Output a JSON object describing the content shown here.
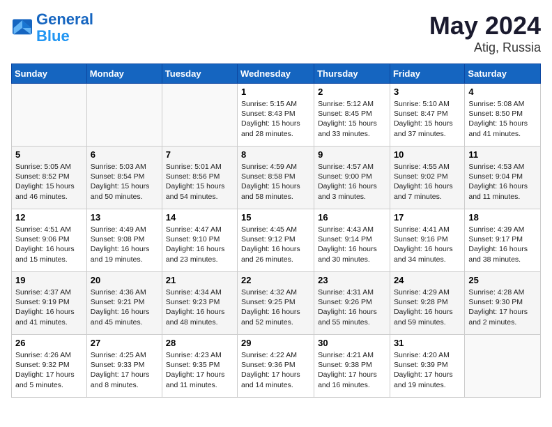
{
  "header": {
    "logo_line1": "General",
    "logo_line2": "Blue",
    "month_year": "May 2024",
    "location": "Atig, Russia"
  },
  "days_of_week": [
    "Sunday",
    "Monday",
    "Tuesday",
    "Wednesday",
    "Thursday",
    "Friday",
    "Saturday"
  ],
  "weeks": [
    [
      {
        "day": "",
        "info": ""
      },
      {
        "day": "",
        "info": ""
      },
      {
        "day": "",
        "info": ""
      },
      {
        "day": "1",
        "info": "Sunrise: 5:15 AM\nSunset: 8:43 PM\nDaylight: 15 hours\nand 28 minutes."
      },
      {
        "day": "2",
        "info": "Sunrise: 5:12 AM\nSunset: 8:45 PM\nDaylight: 15 hours\nand 33 minutes."
      },
      {
        "day": "3",
        "info": "Sunrise: 5:10 AM\nSunset: 8:47 PM\nDaylight: 15 hours\nand 37 minutes."
      },
      {
        "day": "4",
        "info": "Sunrise: 5:08 AM\nSunset: 8:50 PM\nDaylight: 15 hours\nand 41 minutes."
      }
    ],
    [
      {
        "day": "5",
        "info": "Sunrise: 5:05 AM\nSunset: 8:52 PM\nDaylight: 15 hours\nand 46 minutes."
      },
      {
        "day": "6",
        "info": "Sunrise: 5:03 AM\nSunset: 8:54 PM\nDaylight: 15 hours\nand 50 minutes."
      },
      {
        "day": "7",
        "info": "Sunrise: 5:01 AM\nSunset: 8:56 PM\nDaylight: 15 hours\nand 54 minutes."
      },
      {
        "day": "8",
        "info": "Sunrise: 4:59 AM\nSunset: 8:58 PM\nDaylight: 15 hours\nand 58 minutes."
      },
      {
        "day": "9",
        "info": "Sunrise: 4:57 AM\nSunset: 9:00 PM\nDaylight: 16 hours\nand 3 minutes."
      },
      {
        "day": "10",
        "info": "Sunrise: 4:55 AM\nSunset: 9:02 PM\nDaylight: 16 hours\nand 7 minutes."
      },
      {
        "day": "11",
        "info": "Sunrise: 4:53 AM\nSunset: 9:04 PM\nDaylight: 16 hours\nand 11 minutes."
      }
    ],
    [
      {
        "day": "12",
        "info": "Sunrise: 4:51 AM\nSunset: 9:06 PM\nDaylight: 16 hours\nand 15 minutes."
      },
      {
        "day": "13",
        "info": "Sunrise: 4:49 AM\nSunset: 9:08 PM\nDaylight: 16 hours\nand 19 minutes."
      },
      {
        "day": "14",
        "info": "Sunrise: 4:47 AM\nSunset: 9:10 PM\nDaylight: 16 hours\nand 23 minutes."
      },
      {
        "day": "15",
        "info": "Sunrise: 4:45 AM\nSunset: 9:12 PM\nDaylight: 16 hours\nand 26 minutes."
      },
      {
        "day": "16",
        "info": "Sunrise: 4:43 AM\nSunset: 9:14 PM\nDaylight: 16 hours\nand 30 minutes."
      },
      {
        "day": "17",
        "info": "Sunrise: 4:41 AM\nSunset: 9:16 PM\nDaylight: 16 hours\nand 34 minutes."
      },
      {
        "day": "18",
        "info": "Sunrise: 4:39 AM\nSunset: 9:17 PM\nDaylight: 16 hours\nand 38 minutes."
      }
    ],
    [
      {
        "day": "19",
        "info": "Sunrise: 4:37 AM\nSunset: 9:19 PM\nDaylight: 16 hours\nand 41 minutes."
      },
      {
        "day": "20",
        "info": "Sunrise: 4:36 AM\nSunset: 9:21 PM\nDaylight: 16 hours\nand 45 minutes."
      },
      {
        "day": "21",
        "info": "Sunrise: 4:34 AM\nSunset: 9:23 PM\nDaylight: 16 hours\nand 48 minutes."
      },
      {
        "day": "22",
        "info": "Sunrise: 4:32 AM\nSunset: 9:25 PM\nDaylight: 16 hours\nand 52 minutes."
      },
      {
        "day": "23",
        "info": "Sunrise: 4:31 AM\nSunset: 9:26 PM\nDaylight: 16 hours\nand 55 minutes."
      },
      {
        "day": "24",
        "info": "Sunrise: 4:29 AM\nSunset: 9:28 PM\nDaylight: 16 hours\nand 59 minutes."
      },
      {
        "day": "25",
        "info": "Sunrise: 4:28 AM\nSunset: 9:30 PM\nDaylight: 17 hours\nand 2 minutes."
      }
    ],
    [
      {
        "day": "26",
        "info": "Sunrise: 4:26 AM\nSunset: 9:32 PM\nDaylight: 17 hours\nand 5 minutes."
      },
      {
        "day": "27",
        "info": "Sunrise: 4:25 AM\nSunset: 9:33 PM\nDaylight: 17 hours\nand 8 minutes."
      },
      {
        "day": "28",
        "info": "Sunrise: 4:23 AM\nSunset: 9:35 PM\nDaylight: 17 hours\nand 11 minutes."
      },
      {
        "day": "29",
        "info": "Sunrise: 4:22 AM\nSunset: 9:36 PM\nDaylight: 17 hours\nand 14 minutes."
      },
      {
        "day": "30",
        "info": "Sunrise: 4:21 AM\nSunset: 9:38 PM\nDaylight: 17 hours\nand 16 minutes."
      },
      {
        "day": "31",
        "info": "Sunrise: 4:20 AM\nSunset: 9:39 PM\nDaylight: 17 hours\nand 19 minutes."
      },
      {
        "day": "",
        "info": ""
      }
    ]
  ]
}
